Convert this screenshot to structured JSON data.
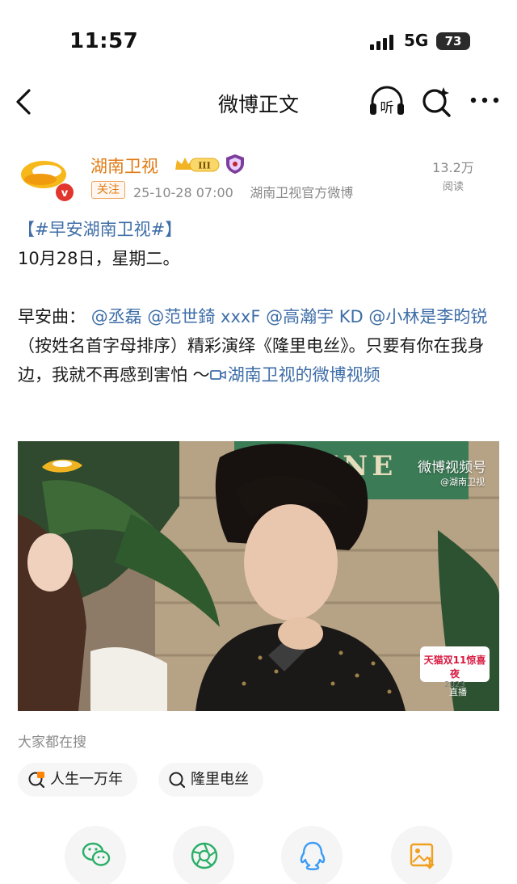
{
  "status_bar": {
    "time": "11:57",
    "network": "5G",
    "battery": "73"
  },
  "nav": {
    "title": "微博正文",
    "back_icon": "chevron-left-icon",
    "listen_label": "听",
    "search_icon": "search-sparkle-icon",
    "more_icon": "more-dots-icon"
  },
  "author": {
    "name": "湖南卫视",
    "follow_label": "关注",
    "timestamp": "25-10-28 07:00",
    "source": "湖南卫视官方微博",
    "views_count": "13.2万",
    "views_label": "阅读",
    "level_badge": "III",
    "brand_color": "#e07b15"
  },
  "post": {
    "tag": "【#早安湖南卫视#】",
    "date_line": "10月28日，星期二。",
    "song_prefix": "早安曲：",
    "mentions": [
      "@丞磊",
      "@范世錡 xxxF",
      "@高瀚宇 KD",
      "@小林是李昀锐"
    ],
    "mid_text": "（按姓名首字母排序）精彩演绎《隆里电丝》。只要有你在我身边，我就不再感到害怕 ～",
    "video_link": "湖南卫视的微博视频",
    "link_color": "#3f6ea8"
  },
  "video": {
    "watermark": "微博视频号",
    "watermark_sub": "@湖南卫视",
    "sign_text": "SATINE",
    "badge_line1": "天猫双11惊喜夜",
    "badge_line2": "2023",
    "live_label": "直播"
  },
  "trending": {
    "title": "大家都在搜",
    "items": [
      {
        "label": "人生一万年",
        "icon": "hot-search-icon"
      },
      {
        "label": "隆里电丝",
        "icon": "search-icon"
      }
    ]
  },
  "share_row": [
    "wechat-icon",
    "moments-icon",
    "qq-icon",
    "save-image-icon"
  ]
}
